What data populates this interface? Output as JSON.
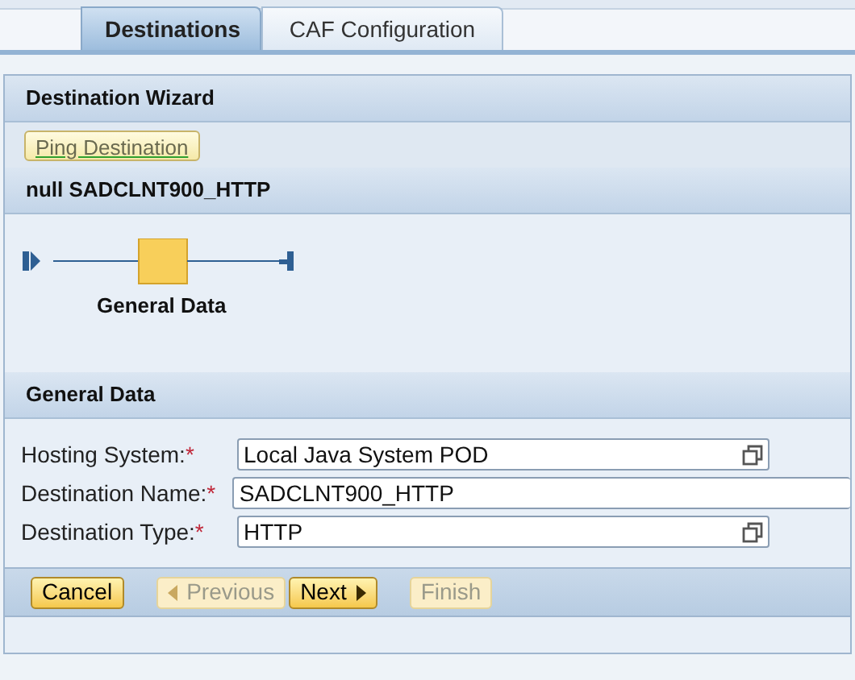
{
  "tabs": [
    {
      "label": "Destinations",
      "selected": true
    },
    {
      "label": "CAF Configuration",
      "selected": false
    }
  ],
  "wizard": {
    "title": "Destination Wizard",
    "ping_button": "Ping Destination",
    "subtitle": "null SADCLNT900_HTTP"
  },
  "roadmap": {
    "steps": [
      {
        "label": "General Data",
        "selected": true
      }
    ]
  },
  "section": {
    "title": "General Data"
  },
  "fields": [
    {
      "label": "Hosting System:",
      "required_mark": "*",
      "value": "Local Java System POD",
      "kind": "valuehelp"
    },
    {
      "label": "Destination Name:",
      "required_mark": "*",
      "value": "SADCLNT900_HTTP",
      "kind": "text"
    },
    {
      "label": "Destination Type:",
      "required_mark": "*",
      "value": "HTTP",
      "kind": "valuehelp"
    }
  ],
  "buttons": [
    {
      "label": "Cancel",
      "disabled": false,
      "kind": "plain"
    },
    {
      "label": "Previous",
      "disabled": true,
      "kind": "back"
    },
    {
      "label": "Next",
      "disabled": false,
      "kind": "forward"
    },
    {
      "label": "Finish",
      "disabled": true,
      "kind": "plain"
    }
  ]
}
